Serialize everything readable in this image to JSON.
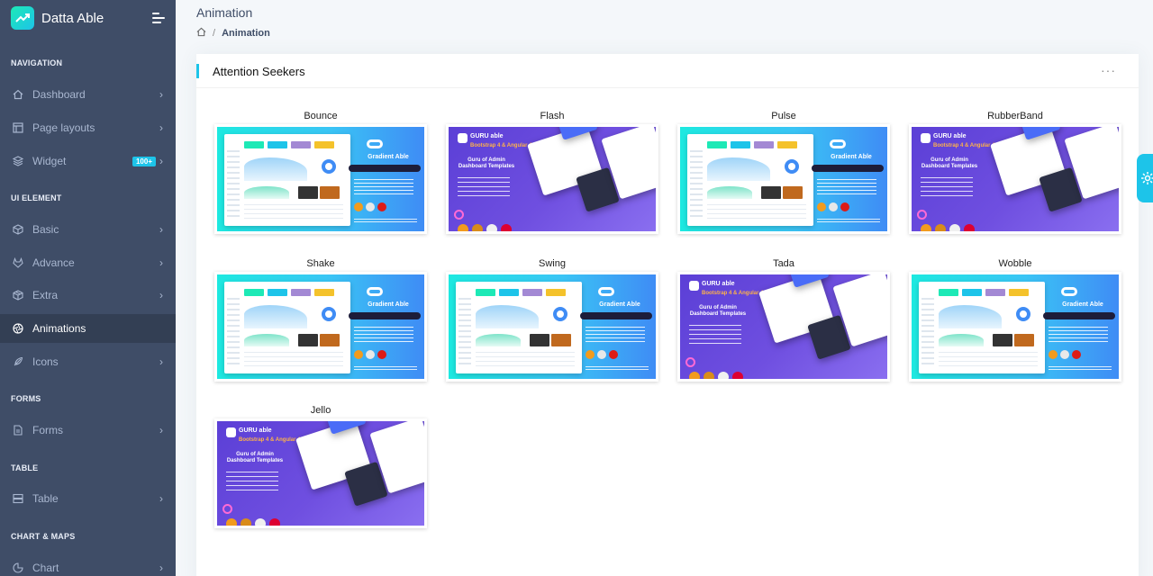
{
  "brand": {
    "name": "Datta Able"
  },
  "sidebar": {
    "captions": {
      "navigation": "NAVIGATION",
      "ui_element": "UI ELEMENT",
      "forms": "FORMS",
      "table": "TABLE",
      "chart_maps": "CHART & MAPS"
    },
    "items": {
      "dashboard": "Dashboard",
      "page_layouts": "Page layouts",
      "widget": "Widget",
      "widget_badge": "100+",
      "basic": "Basic",
      "advance": "Advance",
      "extra": "Extra",
      "animations": "Animations",
      "icons": "Icons",
      "forms": "Forms",
      "table": "Table",
      "chart": "Chart"
    },
    "chevron": "›"
  },
  "page": {
    "title": "Animation",
    "breadcrumb_sep": "/",
    "breadcrumb_current": "Animation"
  },
  "card": {
    "title": "Attention Seekers",
    "menu": "···",
    "items": [
      {
        "label": "Bounce",
        "theme": "gradient-able"
      },
      {
        "label": "Flash",
        "theme": "guru-able"
      },
      {
        "label": "Pulse",
        "theme": "gradient-able"
      },
      {
        "label": "RubberBand",
        "theme": "guru-able"
      },
      {
        "label": "Shake",
        "theme": "gradient-able"
      },
      {
        "label": "Swing",
        "theme": "gradient-able"
      },
      {
        "label": "Tada",
        "theme": "guru-able"
      },
      {
        "label": "Wobble",
        "theme": "gradient-able"
      },
      {
        "label": "Jello",
        "theme": "guru-able"
      }
    ]
  },
  "thumb_text": {
    "gradient_able": "Gradient Able",
    "guru_brand": "GURU able",
    "guru_subtitle": "Bootstrap 4 & Angular 4",
    "guru_heading": "Guru of Admin Dashboard Templates"
  },
  "colors": {
    "sidebar": "#3f4d67",
    "accent": "#1dc4e9",
    "active": "#333f54"
  }
}
